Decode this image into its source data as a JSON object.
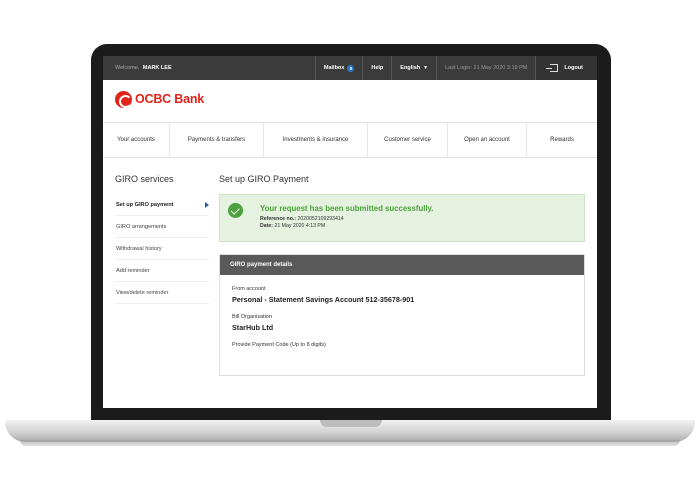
{
  "topbar": {
    "welcome_label": "Welcome,",
    "user_name": "MARK LEE",
    "mailbox_label": "Mailbox",
    "mailbox_count": "0",
    "help_label": "Help",
    "language_label": "English",
    "last_login": "Last Login: 21 May 2020 3:19 PM",
    "logout_label": "Logout"
  },
  "brand": {
    "name": "OCBC Bank",
    "color": "#e2231a"
  },
  "nav": {
    "items": [
      {
        "label": "Your accounts"
      },
      {
        "label": "Payments & transfers"
      },
      {
        "label": "Investments & insurance"
      },
      {
        "label": "Customer service"
      },
      {
        "label": "Open an account"
      },
      {
        "label": "Rewards"
      }
    ]
  },
  "sidebar": {
    "title": "GIRO services",
    "items": [
      {
        "label": "Set up GIRO payment"
      },
      {
        "label": "GIRO arrangements"
      },
      {
        "label": "Withdrawal history"
      },
      {
        "label": "Add reminder"
      },
      {
        "label": "View/delete reminder"
      }
    ]
  },
  "main": {
    "title": "Set up GIRO Payment",
    "success": {
      "message": "Your request has been submitted successfully.",
      "reference_label": "Reference no.:",
      "reference_value": "2020052109293414",
      "date_label": "Date:",
      "date_value": "21 May 2020 4:13 PM"
    },
    "details": {
      "header": "GIRO payment details",
      "from_account_label": "From account",
      "from_account_value": "Personal - Statement Savings Account 512-35678-901",
      "bill_org_label": "Bill Organisation",
      "bill_org_value": "StarHub Ltd",
      "payment_code_label": "Provide Payment Code (Up to 8 digits)"
    }
  },
  "colors": {
    "success_green": "#4ca23c",
    "success_bg": "#e4f2df",
    "topbar_bg": "#3b3b3b",
    "panel_header_bg": "#595959"
  },
  "icons": [
    "logout-icon",
    "check-circle-icon",
    "chevron-down-icon",
    "chevron-right-icon",
    "ocbc-logo-icon"
  ]
}
